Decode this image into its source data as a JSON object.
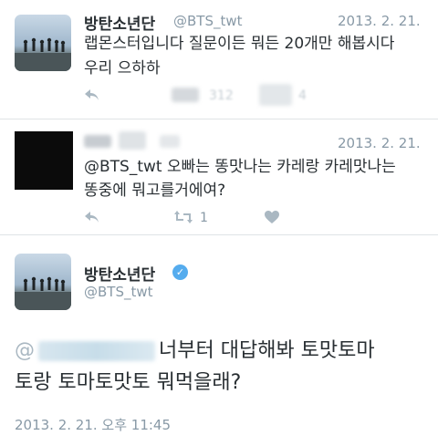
{
  "tweet1": {
    "name": "방탄소년단",
    "handle": "@BTS_twt",
    "date": "2013. 2. 21.",
    "text_line1": "랩몬스터입니다 질문이든 뭐든 20개만 해봅시다",
    "text_line2": "우리 으하하",
    "retweet_count": "312",
    "fav_count": "4"
  },
  "tweet2": {
    "date": "2013. 2. 21.",
    "text_line1": "@BTS_twt 오빠는 똥맛나는 카레랑 카레맛나는",
    "text_line2": "똥중에 뭐고를거에여?",
    "retweet_count": "1"
  },
  "tweet3": {
    "name": "방탄소년단",
    "handle": "@BTS_twt",
    "mention_prefix": "@",
    "text_line1": "너부터 대답해봐 토맛토마",
    "text_line2": "토랑 토마토맛토 뭐먹을래?",
    "timestamp": "2013. 2. 21. 오후 11:45"
  },
  "icons": [
    "reply-icon",
    "retweet-icon",
    "heart-icon",
    "verified-icon"
  ],
  "colors": {
    "muted": "#8899a6",
    "text": "#292f33",
    "verified": "#55acee"
  }
}
